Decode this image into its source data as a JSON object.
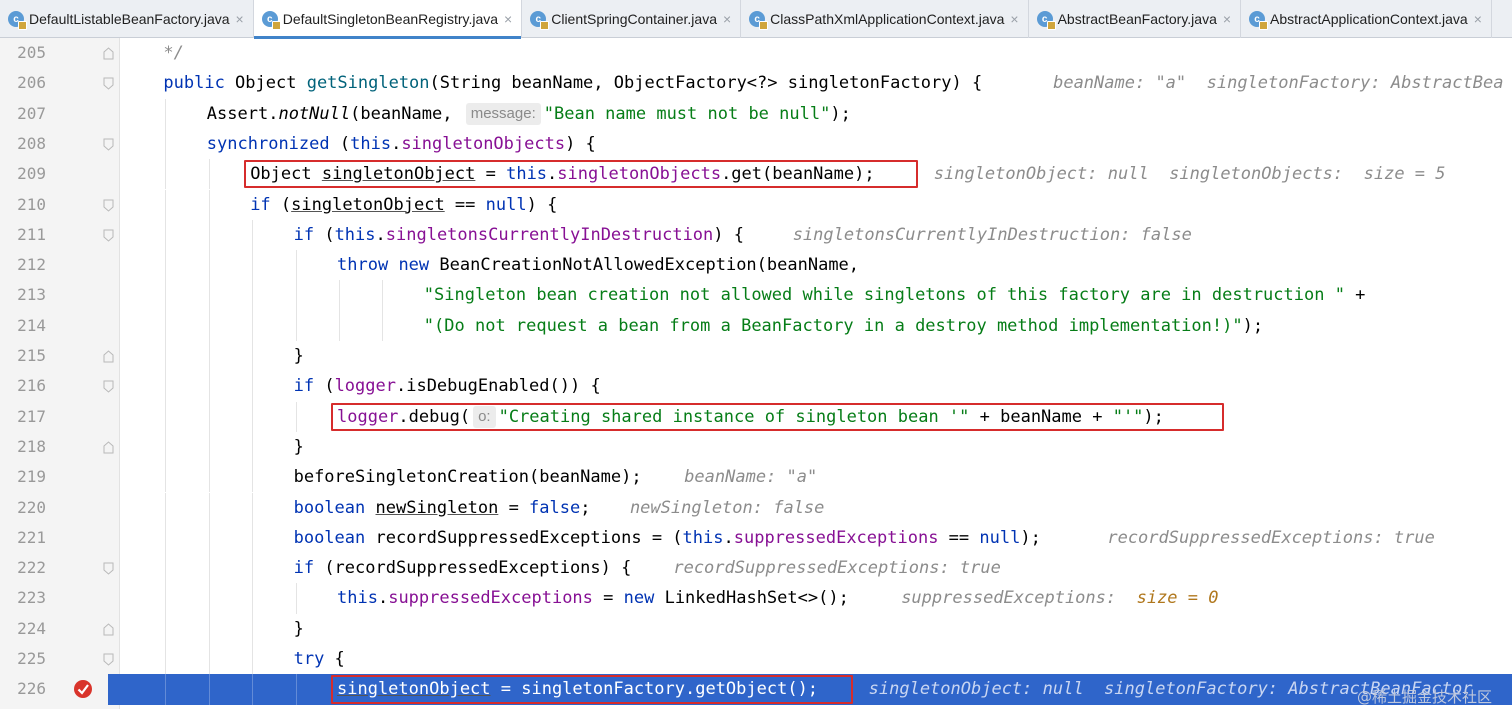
{
  "tabs": [
    {
      "label": "DefaultListableBeanFactory.java",
      "icon": "class-icon",
      "active": false
    },
    {
      "label": "DefaultSingletonBeanRegistry.java",
      "icon": "class-icon",
      "active": true
    },
    {
      "label": "ClientSpringContainer.java",
      "icon": "class-icon",
      "active": false
    },
    {
      "label": "ClassPathXmlApplicationContext.java",
      "icon": "class-icon",
      "active": false
    },
    {
      "label": "AbstractBeanFactory.java",
      "icon": "class-icon",
      "active": false
    },
    {
      "label": "AbstractApplicationContext.java",
      "icon": "class-icon",
      "active": false
    }
  ],
  "close_glyph": "×",
  "lines": [
    {
      "num": "205",
      "indent": 1,
      "code": "*/",
      "fold": "end"
    },
    {
      "num": "206",
      "indent": 1,
      "fold": "start",
      "code": "public Object getSingleton(String beanName, ObjectFactory<?> singletonFactory) {",
      "inline": "beanName: \"a\"  singletonFactory: AbstractBea"
    },
    {
      "num": "207",
      "indent": 2,
      "code": "Assert.notNull(beanName, ",
      "hint": "message:",
      "code_after": "\"Bean name must not be null\");"
    },
    {
      "num": "208",
      "indent": 2,
      "fold": "start",
      "code": "synchronized (this.singletonObjects) {"
    },
    {
      "num": "209",
      "indent": 3,
      "code": "Object singletonObject = this.singletonObjects.get(beanName);",
      "inline": "singletonObject: null  singletonObjects:  size = 5"
    },
    {
      "num": "210",
      "indent": 3,
      "fold": "start",
      "code": "if (singletonObject == null) {"
    },
    {
      "num": "211",
      "indent": 4,
      "fold": "start",
      "code": "if (this.singletonsCurrentlyInDestruction) {",
      "inline": "singletonsCurrentlyInDestruction: false"
    },
    {
      "num": "212",
      "indent": 5,
      "code": "throw new BeanCreationNotAllowedException(beanName,"
    },
    {
      "num": "213",
      "indent": 7,
      "code": "\"Singleton bean creation not allowed while singletons of this factory are in destruction \" +"
    },
    {
      "num": "214",
      "indent": 7,
      "code": "\"(Do not request a bean from a BeanFactory in a destroy method implementation!)\");"
    },
    {
      "num": "215",
      "indent": 4,
      "fold": "end",
      "code": "}"
    },
    {
      "num": "216",
      "indent": 4,
      "fold": "start",
      "code": "if (logger.isDebugEnabled()) {"
    },
    {
      "num": "217",
      "indent": 5,
      "code": "logger.debug(",
      "hint": "o:",
      "code_after": "\"Creating shared instance of singleton bean '\" + beanName + \"'\");"
    },
    {
      "num": "218",
      "indent": 4,
      "fold": "end",
      "code": "}"
    },
    {
      "num": "219",
      "indent": 4,
      "code": "beforeSingletonCreation(beanName);",
      "inline": "beanName: \"a\""
    },
    {
      "num": "220",
      "indent": 4,
      "code": "boolean newSingleton = false;",
      "inline": "newSingleton: false"
    },
    {
      "num": "221",
      "indent": 4,
      "code": "boolean recordSuppressedExceptions = (this.suppressedExceptions == null);",
      "inline": "recordSuppressedExceptions: true"
    },
    {
      "num": "222",
      "indent": 4,
      "fold": "start",
      "code": "if (recordSuppressedExceptions) {",
      "inline": "recordSuppressedExceptions: true"
    },
    {
      "num": "223",
      "indent": 5,
      "code": "this.suppressedExceptions = new LinkedHashSet<>();",
      "inline": "suppressedExceptions:  ",
      "inline_value": "size = 0"
    },
    {
      "num": "224",
      "indent": 4,
      "fold": "end",
      "code": "}"
    },
    {
      "num": "225",
      "indent": 4,
      "fold": "start",
      "code": "try {"
    },
    {
      "num": "226",
      "indent": 5,
      "code": "singletonObject = singletonFactory.getObject();",
      "inline": "singletonObject: null  singletonFactory: AbstractBeanFactor",
      "execution_point": true,
      "breakpoint": true
    }
  ],
  "watermark": "@稀土掘金技术社区",
  "colors": {
    "keyword": "#0033b3",
    "field": "#871094",
    "string": "#067d17",
    "execution_line": "#2f65ca",
    "breakpoint": "#d9342b",
    "highlight_box": "#d62c2c"
  }
}
